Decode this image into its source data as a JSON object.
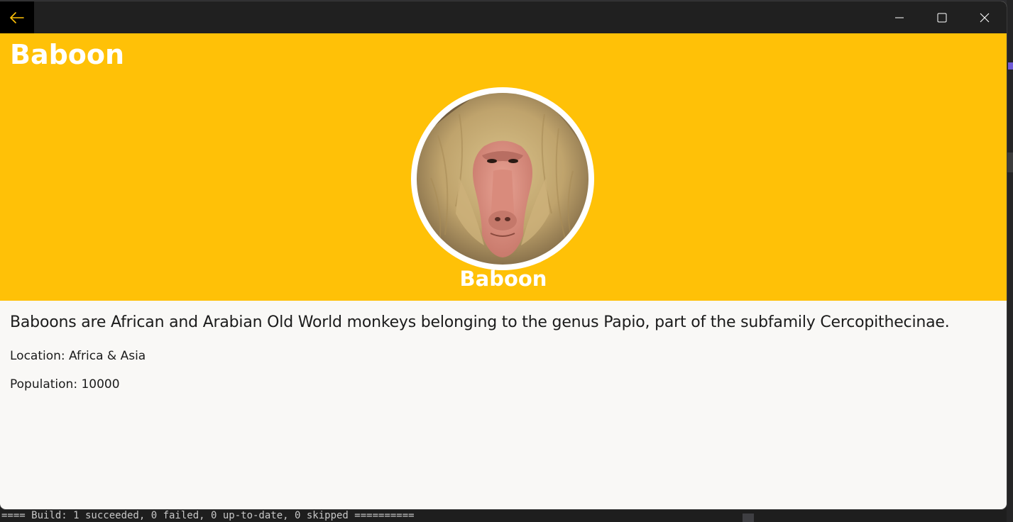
{
  "window": {
    "back_icon": "arrow-left-icon",
    "minimize_icon": "minimize-icon",
    "maximize_icon": "maximize-icon",
    "close_icon": "close-icon",
    "accent": "#ffc107"
  },
  "header": {
    "title": "Baboon",
    "hero_name": "Baboon",
    "background": "#ffc107"
  },
  "details": {
    "description": "Baboons are African and Arabian Old World monkeys belonging to the genus Papio, part of the subfamily Cercopithecinae.",
    "location_label": "Location: Africa & Asia",
    "population_label": "Population: 10000"
  },
  "output_panel": {
    "text": "==== Build: 1 succeeded, 0 failed, 0 up-to-date, 0 skipped =========="
  }
}
